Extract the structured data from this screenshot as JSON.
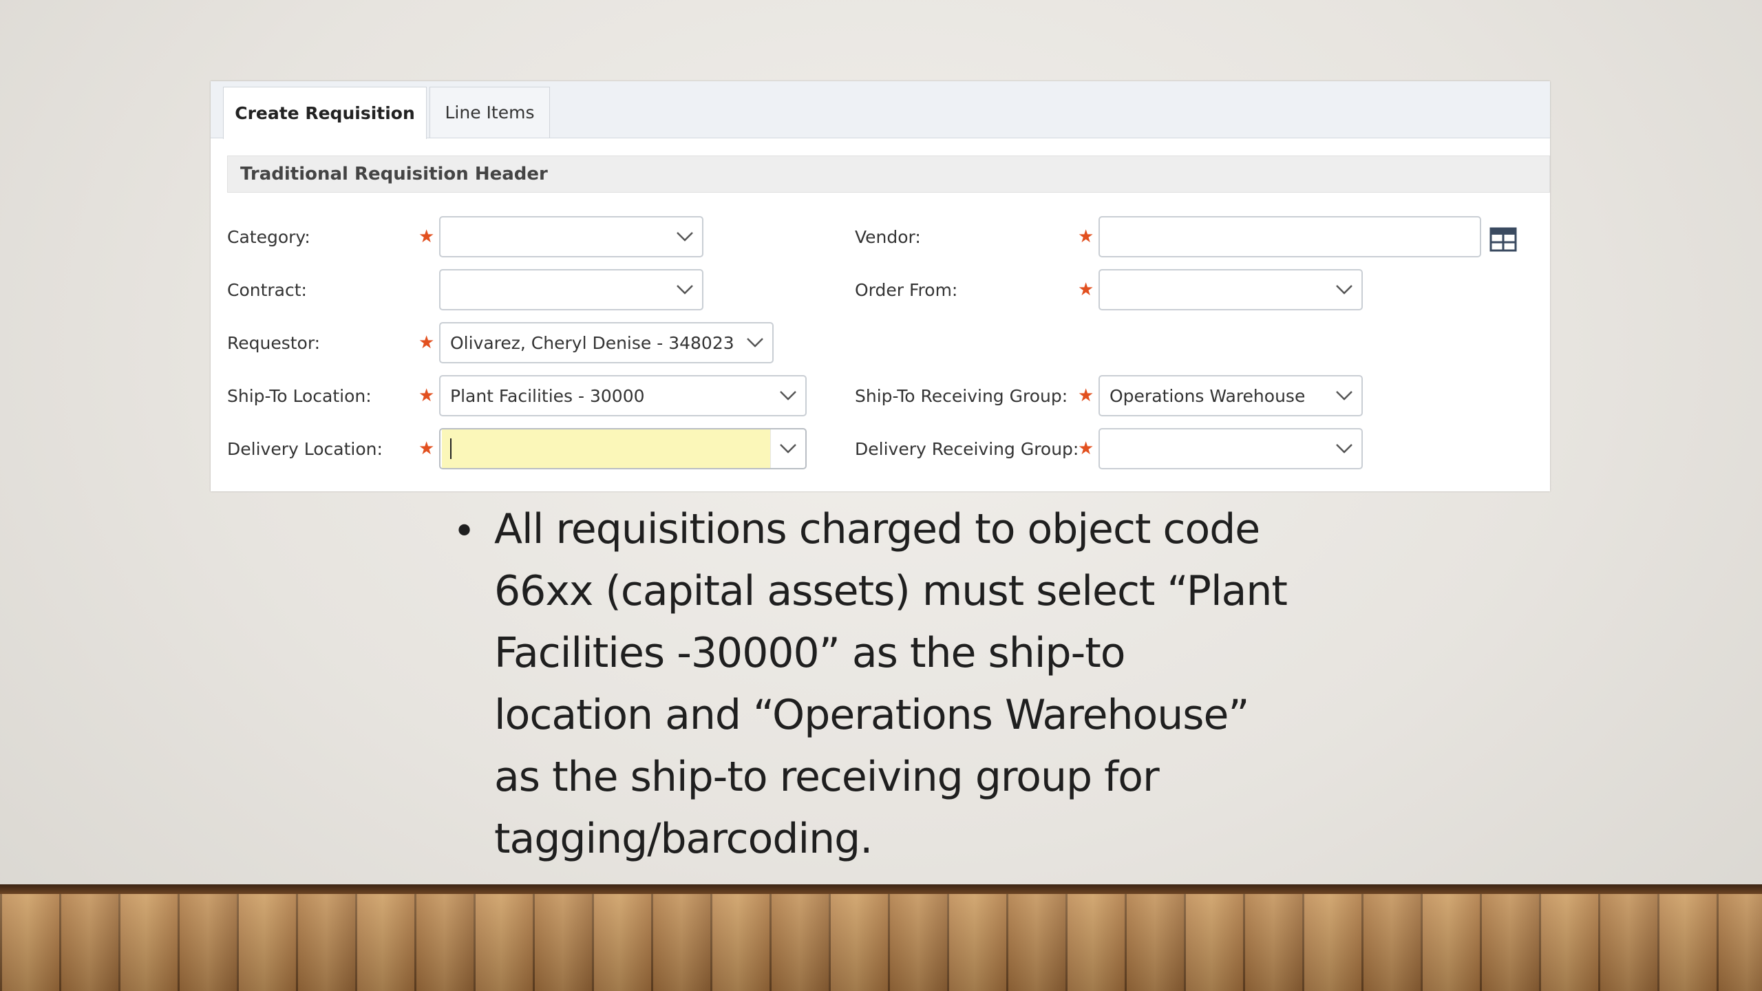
{
  "tabs": [
    {
      "label": "Create Requisition",
      "active": true
    },
    {
      "label": "Line Items",
      "active": false
    }
  ],
  "section_title": "Traditional Requisition Header",
  "fields": {
    "category": {
      "label": "Category:",
      "value": ""
    },
    "contract": {
      "label": "Contract:",
      "value": ""
    },
    "requestor": {
      "label": "Requestor:",
      "value": "Olivarez, Cheryl Denise - 348023"
    },
    "ship_to_location": {
      "label": "Ship-To Location:",
      "value": "Plant Facilities - 30000"
    },
    "delivery_location": {
      "label": "Delivery Location:",
      "value": ""
    },
    "vendor": {
      "label": "Vendor:",
      "value": ""
    },
    "order_from": {
      "label": "Order From:",
      "value": ""
    },
    "ship_to_receiving_group": {
      "label": "Ship-To Receiving Group:",
      "value": "Operations Warehouse"
    },
    "delivery_receiving_group": {
      "label": "Delivery Receiving Group:",
      "value": ""
    }
  },
  "required_marker": "★",
  "bullet": {
    "lines": [
      "All requisitions charged to object code",
      "66xx (capital assets) must select “Plant",
      "Facilities -30000” as the ship-to",
      "location and “Operations Warehouse”",
      "as the ship-to receiving group for",
      "tagging/barcoding."
    ],
    "marker": "•"
  },
  "colors": {
    "required_star": "#e2501f",
    "focused_field_bg": "#fbf7b9",
    "slide_bg": "#e7e4df",
    "floor": "#b8844f"
  },
  "icons": {
    "chevron": "chevron-down-icon",
    "vendor_lookup": "grid-table-icon"
  }
}
